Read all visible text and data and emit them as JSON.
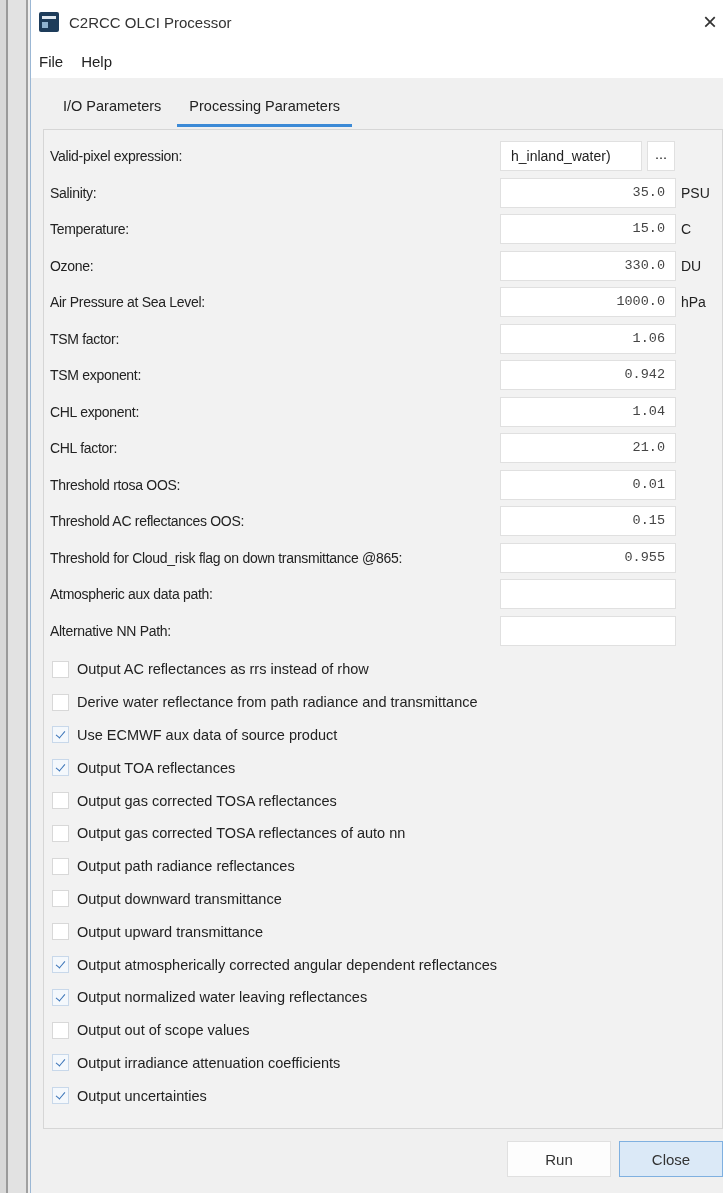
{
  "window": {
    "title": "C2RCC OLCI Processor",
    "close": "×"
  },
  "menu": [
    "File",
    "Help"
  ],
  "tabs": [
    {
      "label": "I/O Parameters",
      "selected": false
    },
    {
      "label": "Processing Parameters",
      "selected": true
    }
  ],
  "parameters": [
    {
      "kind": "expression",
      "label": "Valid-pixel expression:",
      "value": "h_inland_water)",
      "button": "..."
    },
    {
      "kind": "number",
      "label": "Salinity:",
      "value": "35.0",
      "unit": "PSU"
    },
    {
      "kind": "number",
      "label": "Temperature:",
      "value": "15.0",
      "unit": "C"
    },
    {
      "kind": "number",
      "label": "Ozone:",
      "value": "330.0",
      "unit": "DU"
    },
    {
      "kind": "number",
      "label": "Air Pressure at Sea Level:",
      "value": "1000.0",
      "unit": "hPa"
    },
    {
      "kind": "number",
      "label": "TSM factor:",
      "value": "1.06"
    },
    {
      "kind": "number",
      "label": "TSM exponent:",
      "value": "0.942"
    },
    {
      "kind": "number",
      "label": "CHL exponent:",
      "value": "1.04"
    },
    {
      "kind": "number",
      "label": "CHL factor:",
      "value": "21.0"
    },
    {
      "kind": "number",
      "label": "Threshold rtosa OOS:",
      "value": "0.01"
    },
    {
      "kind": "number",
      "label": "Threshold AC reflectances OOS:",
      "value": "0.15"
    },
    {
      "kind": "number",
      "label": "Threshold for Cloud_risk flag on down transmittance @865:",
      "value": "0.955"
    },
    {
      "kind": "path",
      "label": "Atmospheric aux data path:"
    },
    {
      "kind": "path",
      "label": "Alternative NN Path:"
    }
  ],
  "options": [
    {
      "label": "Output AC reflectances as rrs instead of rhow",
      "checked": false
    },
    {
      "label": "Derive water reflectance from path radiance and transmittance",
      "checked": false
    },
    {
      "label": "Use ECMWF aux data of source product",
      "checked": true
    },
    {
      "label": "Output TOA reflectances",
      "checked": true
    },
    {
      "label": "Output gas corrected TOSA reflectances",
      "checked": false
    },
    {
      "label": "Output gas corrected TOSA reflectances of auto nn",
      "checked": false
    },
    {
      "label": "Output path radiance reflectances",
      "checked": false
    },
    {
      "label": "Output downward transmittance",
      "checked": false
    },
    {
      "label": "Output upward transmittance",
      "checked": false
    },
    {
      "label": "Output atmospherically corrected angular dependent reflectances",
      "checked": true
    },
    {
      "label": "Output normalized water leaving reflectances",
      "checked": true
    },
    {
      "label": "Output out of scope values",
      "checked": false
    },
    {
      "label": "Output irradiance attenuation coefficients",
      "checked": true
    },
    {
      "label": "Output uncertainties",
      "checked": true
    }
  ],
  "buttons": [
    {
      "label": "Run",
      "selected": false
    },
    {
      "label": "Close",
      "selected": true
    }
  ]
}
